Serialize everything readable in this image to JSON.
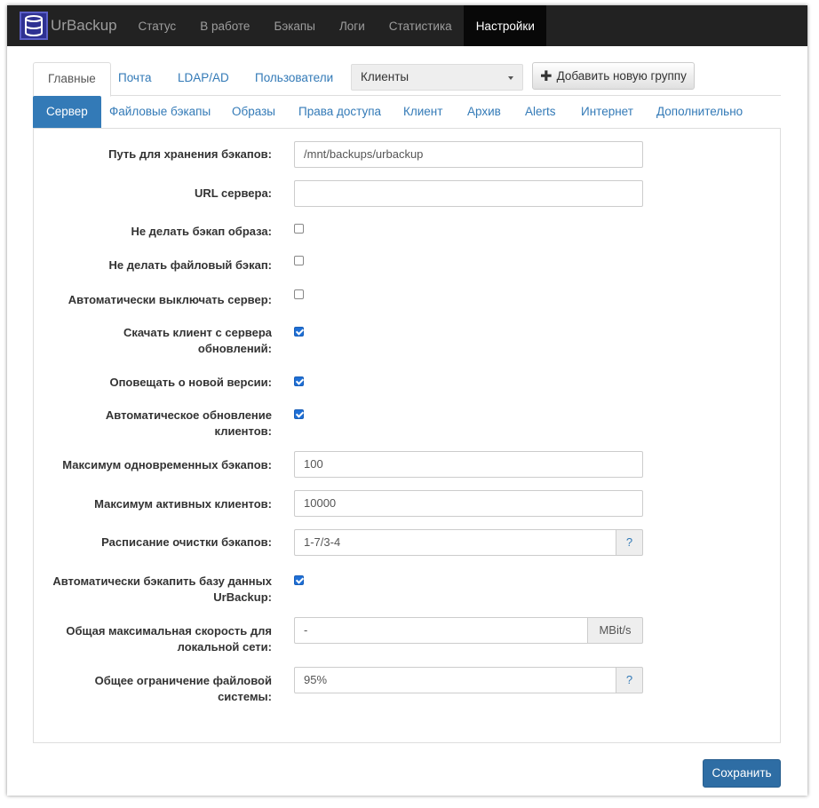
{
  "navbar": {
    "brand": "UrBackup",
    "items": [
      "Статус",
      "В работе",
      "Бэкапы",
      "Логи",
      "Статистика",
      "Настройки"
    ],
    "active": "Настройки"
  },
  "tabs_main": {
    "items": [
      "Главные",
      "Почта",
      "LDAP/AD",
      "Пользователи"
    ],
    "active": "Главные",
    "group_select_value": "Клиенты",
    "add_group_label": "Добавить новую группу"
  },
  "tabs_sub": {
    "items": [
      "Сервер",
      "Файловые бэкапы",
      "Образы",
      "Права доступа",
      "Клиент",
      "Архив",
      "Alerts",
      "Интернет",
      "Дополнительно"
    ],
    "active": "Сервер"
  },
  "form": {
    "backup_path": {
      "label": "Путь для хранения бэкапов:",
      "value": "/mnt/backups/urbackup"
    },
    "server_url": {
      "label": "URL сервера:",
      "value": ""
    },
    "no_image_backup": {
      "label": "Не делать бэкап образа:",
      "checked": false
    },
    "no_file_backup": {
      "label": "Не делать файловый бэкап:",
      "checked": false
    },
    "auto_shutdown": {
      "label": "Автоматически выключать сервер:",
      "checked": false
    },
    "download_client": {
      "label_1": "Скачать клиент с сервера",
      "label_2": "обновлений:",
      "checked": true
    },
    "notify_new_version": {
      "label": "Оповещать о новой версии:",
      "checked": true
    },
    "auto_update_clients": {
      "label_1": "Автоматическое обновление",
      "label_2": "клиентов:",
      "checked": true
    },
    "max_simultaneous": {
      "label": "Максимум одновременных бэкапов:",
      "value": "100"
    },
    "max_active_clients": {
      "label": "Максимум активных клиентов:",
      "value": "10000"
    },
    "cleanup_schedule": {
      "label": "Расписание очистки бэкапов:",
      "value": "1-7/3-4",
      "help": "?"
    },
    "auto_backup_db": {
      "label_1": "Автоматически бэкапить базу данных",
      "label_2": "UrBackup:",
      "checked": true
    },
    "max_speed_local": {
      "label_1": "Общая максимальная скорость для",
      "label_2": "локальной сети:",
      "value": "-",
      "unit": "MBit/s"
    },
    "fs_limit": {
      "label_1": "Общее ограничение файловой",
      "label_2": "системы:",
      "value": "95%",
      "help": "?"
    }
  },
  "save_label": "Сохранить"
}
